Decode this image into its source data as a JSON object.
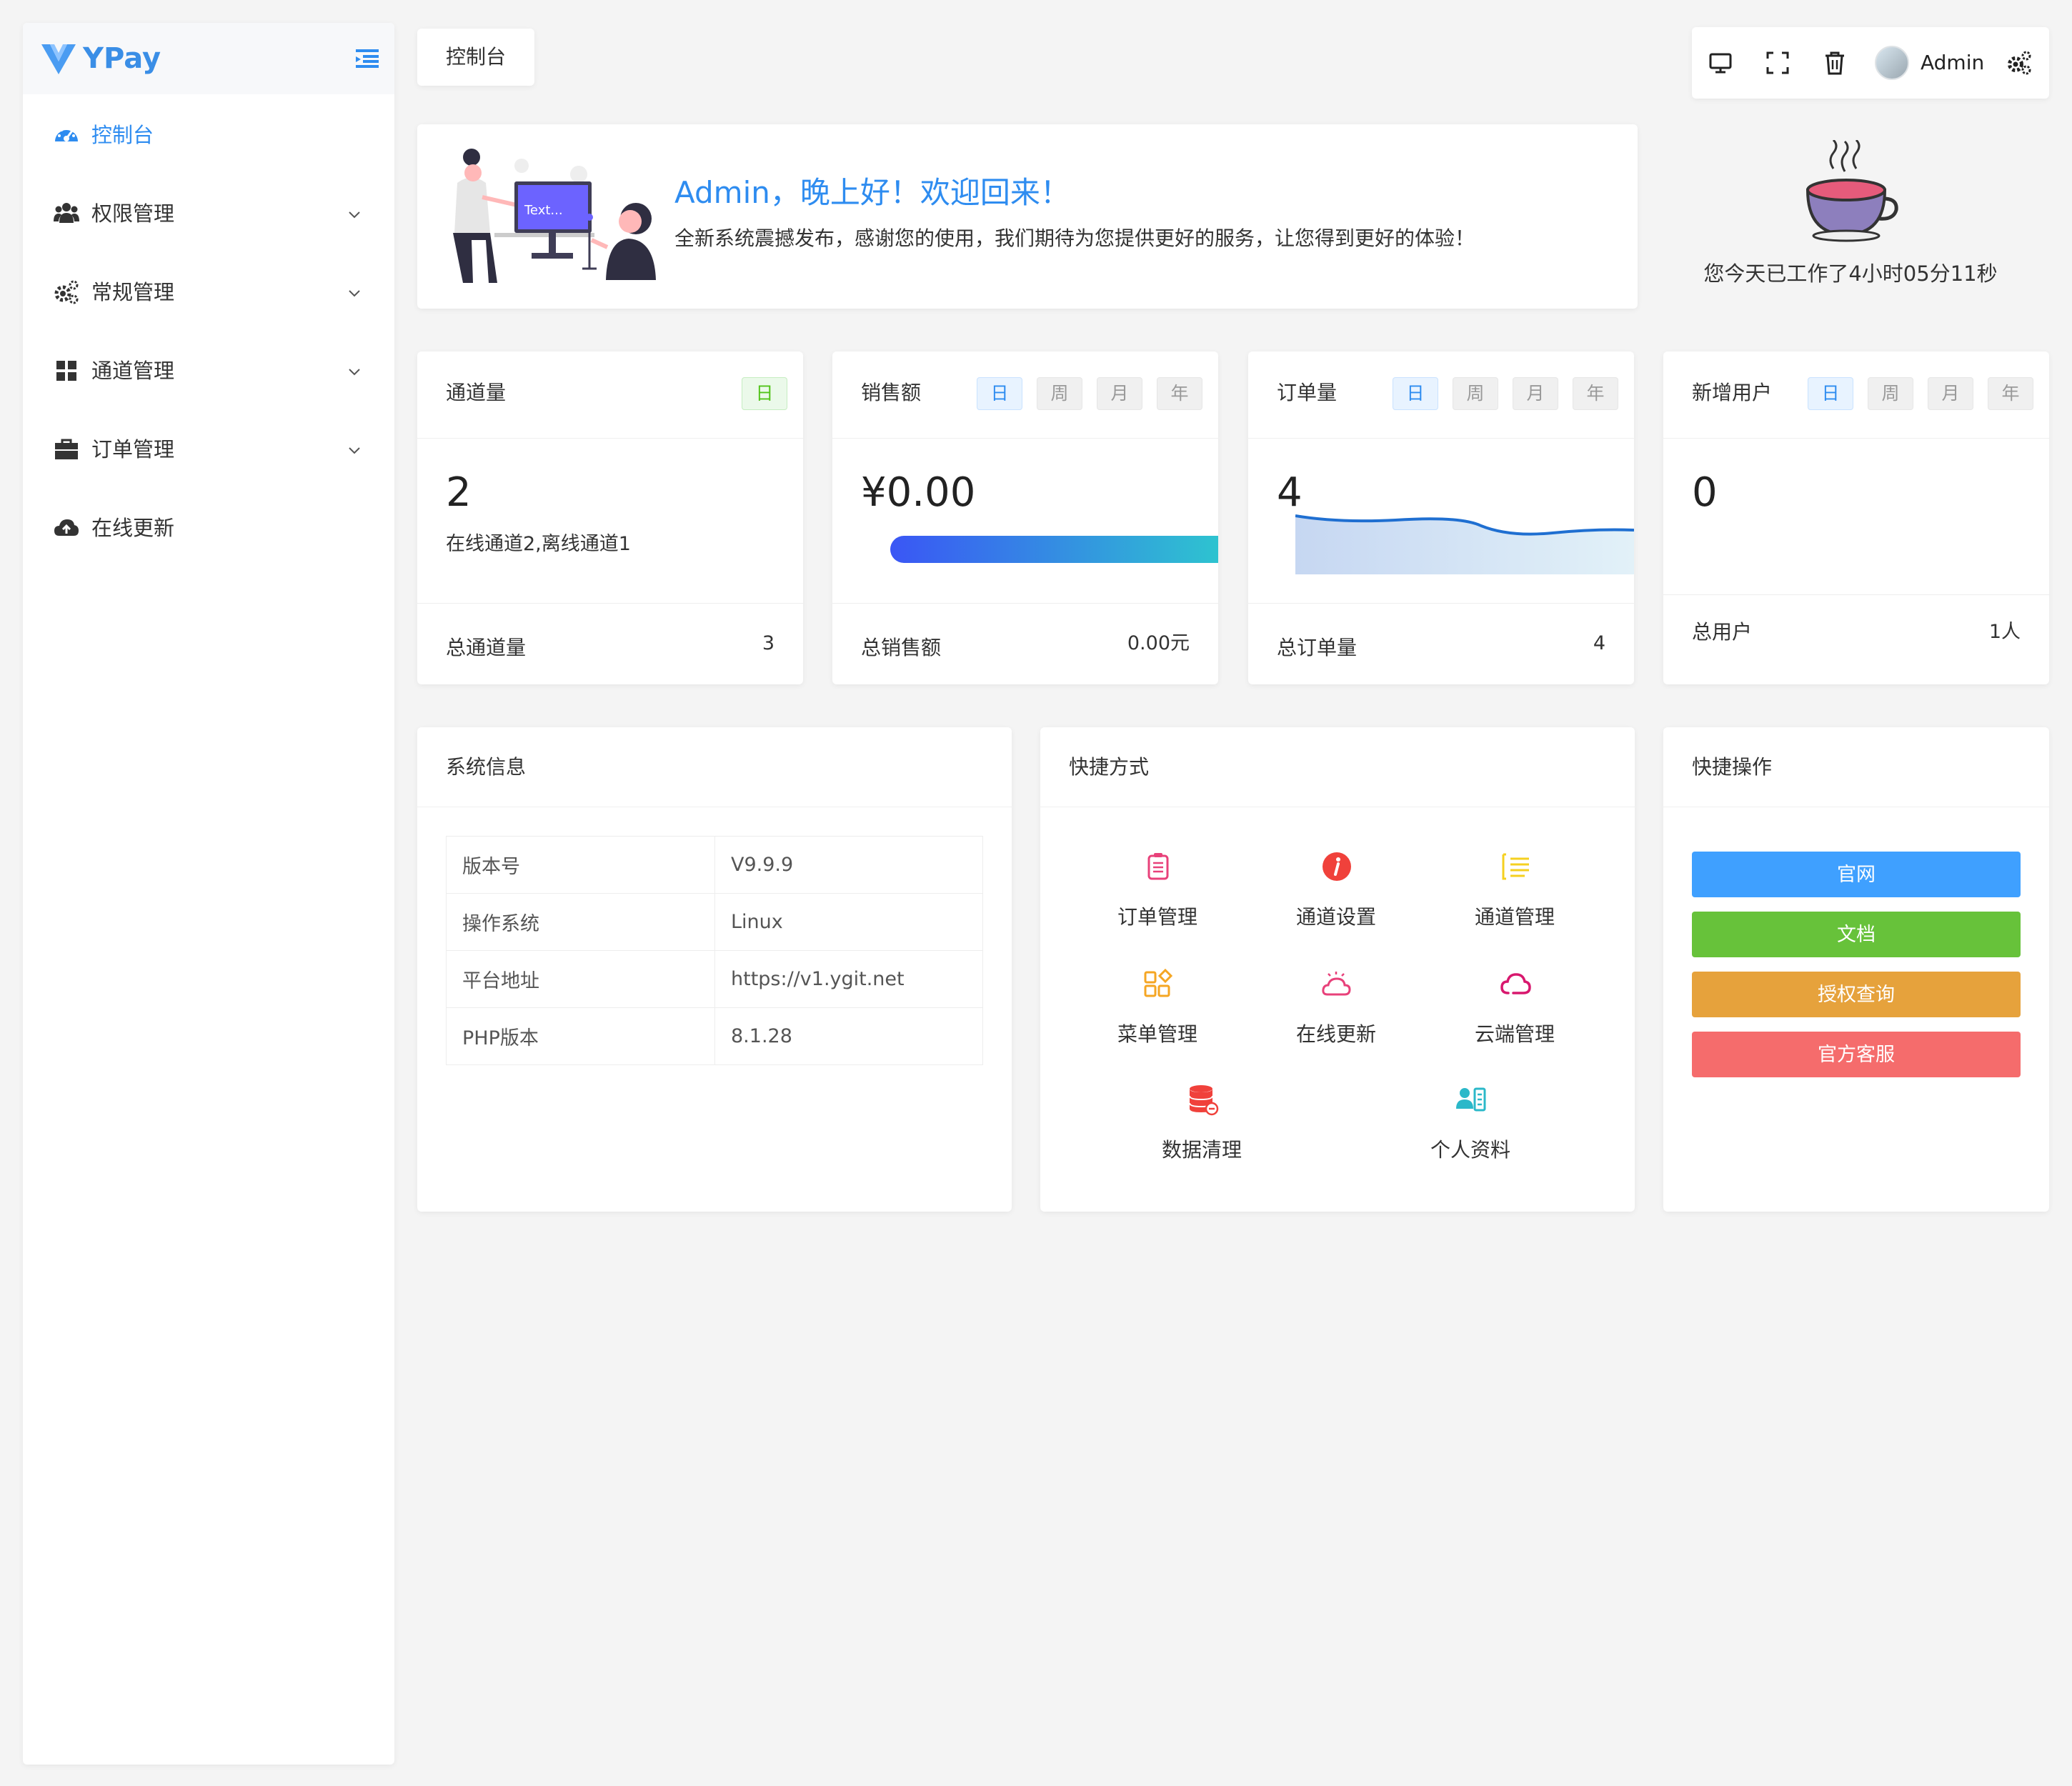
{
  "app": {
    "logo_text": "YPay"
  },
  "sidebar": {
    "items": [
      {
        "label": "控制台",
        "icon": "dashboard-icon",
        "active": true
      },
      {
        "label": "权限管理",
        "icon": "users-icon"
      },
      {
        "label": "常规管理",
        "icon": "cogs-icon"
      },
      {
        "label": "通道管理",
        "icon": "grid-icon"
      },
      {
        "label": "订单管理",
        "icon": "briefcase-icon"
      },
      {
        "label": "在线更新",
        "icon": "cloud-upload-icon"
      }
    ]
  },
  "header": {
    "tab_label": "控制台",
    "user_name": "Admin"
  },
  "welcome": {
    "title": "Admin，晚上好！欢迎回来！",
    "subtitle": "全新系统震撼发布，感谢您的使用，我们期待为您提供更好的服务，让您得到更好的体验！",
    "illustration_text": "Text..."
  },
  "worktime": "您今天已工作了4小时05分11秒",
  "stats": [
    {
      "title": "通道量",
      "badges": [
        "日"
      ],
      "value": "2",
      "sub": "在线通道2,离线通道1",
      "footer_label": "总通道量",
      "footer_value": "3"
    },
    {
      "title": "销售额",
      "badges": [
        "日",
        "周",
        "月",
        "年"
      ],
      "value": "¥0.00",
      "footer_label": "总销售额",
      "footer_value": "0.00元"
    },
    {
      "title": "订单量",
      "badges": [
        "日",
        "周",
        "月",
        "年"
      ],
      "value": "4",
      "footer_label": "总订单量",
      "footer_value": "4"
    },
    {
      "title": "新增用户",
      "badges": [
        "日",
        "周",
        "月",
        "年"
      ],
      "value": "0",
      "footer_label": "总用户",
      "footer_value": "1人"
    }
  ],
  "system_info": {
    "title": "系统信息",
    "rows": [
      {
        "key": "版本号",
        "value": "V9.9.9"
      },
      {
        "key": "操作系统",
        "value": "Linux"
      },
      {
        "key": "平台地址",
        "value": "https://v1.ygit.net"
      },
      {
        "key": "PHP版本",
        "value": "8.1.28"
      }
    ]
  },
  "shortcuts": {
    "title": "快捷方式",
    "items": [
      {
        "label": "订单管理",
        "icon": "order-list-icon"
      },
      {
        "label": "通道设置",
        "icon": "info-icon"
      },
      {
        "label": "通道管理",
        "icon": "list-icon"
      },
      {
        "label": "菜单管理",
        "icon": "menu-grid-icon"
      },
      {
        "label": "在线更新",
        "icon": "cloud-sun-icon"
      },
      {
        "label": "云端管理",
        "icon": "cloud-icon"
      },
      {
        "label": "数据清理",
        "icon": "database-icon"
      },
      {
        "label": "个人资料",
        "icon": "profile-card-icon"
      }
    ]
  },
  "quick_ops": {
    "title": "快捷操作",
    "buttons": [
      {
        "label": "官网",
        "color": "#3fa0ff"
      },
      {
        "label": "文档",
        "color": "#67c23a"
      },
      {
        "label": "授权查询",
        "color": "#e6a23c"
      },
      {
        "label": "官方客服",
        "color": "#f56c6c"
      }
    ]
  },
  "colors": {
    "primary": "#2e8cf0",
    "page_bg": "#f4f4f4"
  }
}
